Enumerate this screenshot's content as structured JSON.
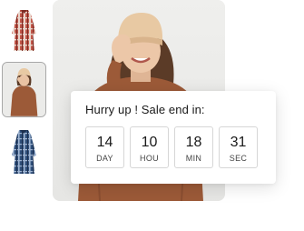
{
  "gallery": {
    "thumbnails": [
      {
        "name": "Red plaid shirt dress",
        "selected": false
      },
      {
        "name": "Brown knit sweater",
        "selected": true
      },
      {
        "name": "Blue plaid shirt dress",
        "selected": false
      }
    ]
  },
  "countdown": {
    "title": "Hurry up ! Sale end in:",
    "units": [
      {
        "value": "14",
        "label": "DAY"
      },
      {
        "value": "10",
        "label": "HOU"
      },
      {
        "value": "18",
        "label": "MIN"
      },
      {
        "value": "31",
        "label": "SEC"
      }
    ]
  },
  "colors": {
    "selected_border": "#a8a8a8",
    "sweater": "#9c5a38",
    "beanie": "#e8c9a3",
    "card_border": "#d6d6d6"
  }
}
